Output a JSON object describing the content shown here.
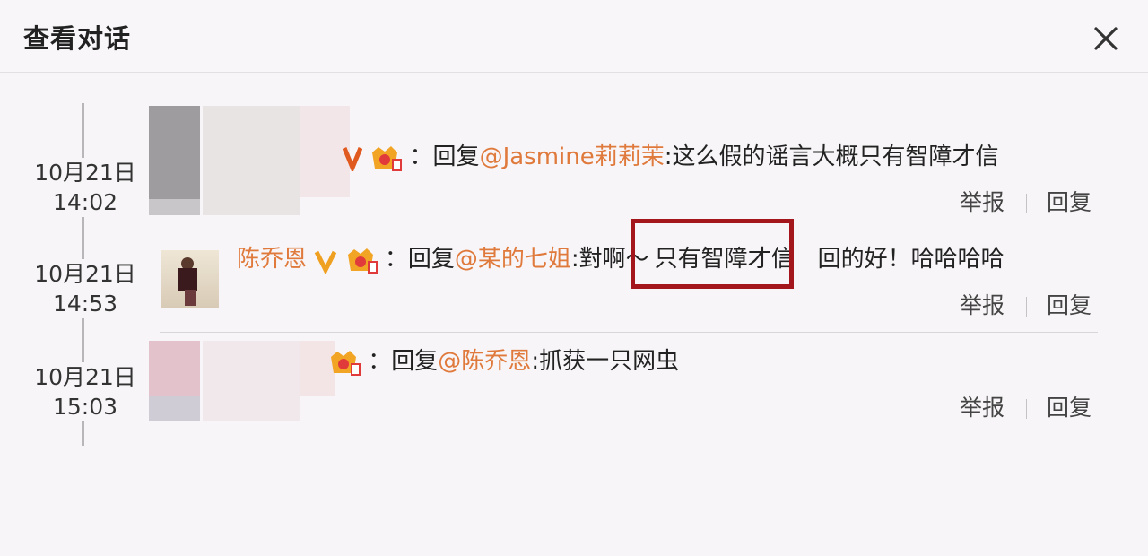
{
  "dialog": {
    "title": "查看对话"
  },
  "comments": [
    {
      "date": "10月21日",
      "time": "14:02",
      "name": "",
      "separator": "：",
      "reply_prefix": "回复",
      "mention": "@Jasmine莉莉茉",
      "body_before": ":这么假的谣言大概只有智障才信",
      "report_label": "举报",
      "reply_label": "回复"
    },
    {
      "date": "10月21日",
      "time": "14:53",
      "name": "陈乔恩",
      "separator": "：",
      "reply_prefix": "回复",
      "mention": "@某的七姐",
      "body_before": ":對啊～",
      "body_highlight": "只有智障才信",
      "body_after": "回的好！哈哈哈哈",
      "report_label": "举报",
      "reply_label": "回复"
    },
    {
      "date": "10月21日",
      "time": "15:03",
      "name": "",
      "separator": "：",
      "reply_prefix": "回复",
      "mention": "@陈乔恩",
      "body_before": ":抓获一只网虫",
      "report_label": "举报",
      "reply_label": "回复"
    }
  ],
  "colors": {
    "mention": "#e07a3c",
    "highlight_border": "#a3161c",
    "verified": "#f0a020"
  },
  "icons": {
    "close": "close-icon",
    "verified": "verified-v-icon",
    "crown": "crown-badge-icon"
  }
}
